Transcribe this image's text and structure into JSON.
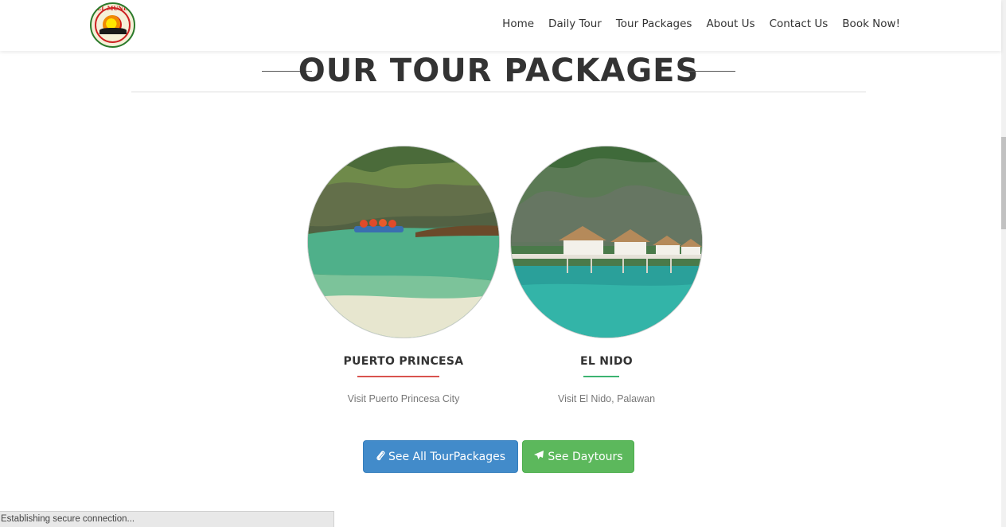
{
  "nav": {
    "logo_text": "DEL MUNDO",
    "items": [
      "Home",
      "Daily Tour",
      "Tour Packages",
      "About Us",
      "Contact Us",
      "Book Now!"
    ]
  },
  "section": {
    "title": "OUR TOUR PACKAGES"
  },
  "packages": [
    {
      "name": "PUERTO PRINCESA",
      "description": "Visit Puerto Princesa City",
      "accent_color": "#d9534f"
    },
    {
      "name": "EL NIDO",
      "description": "Visit El Nido, Palawan",
      "accent_color": "#3cb371"
    }
  ],
  "buttons": {
    "all_packages": {
      "label": "See All TourPackages",
      "icon": "paperclip-icon"
    },
    "daytours": {
      "label": "See Daytours",
      "icon": "plane-icon"
    }
  },
  "status_bar": {
    "text": "Establishing secure connection..."
  }
}
